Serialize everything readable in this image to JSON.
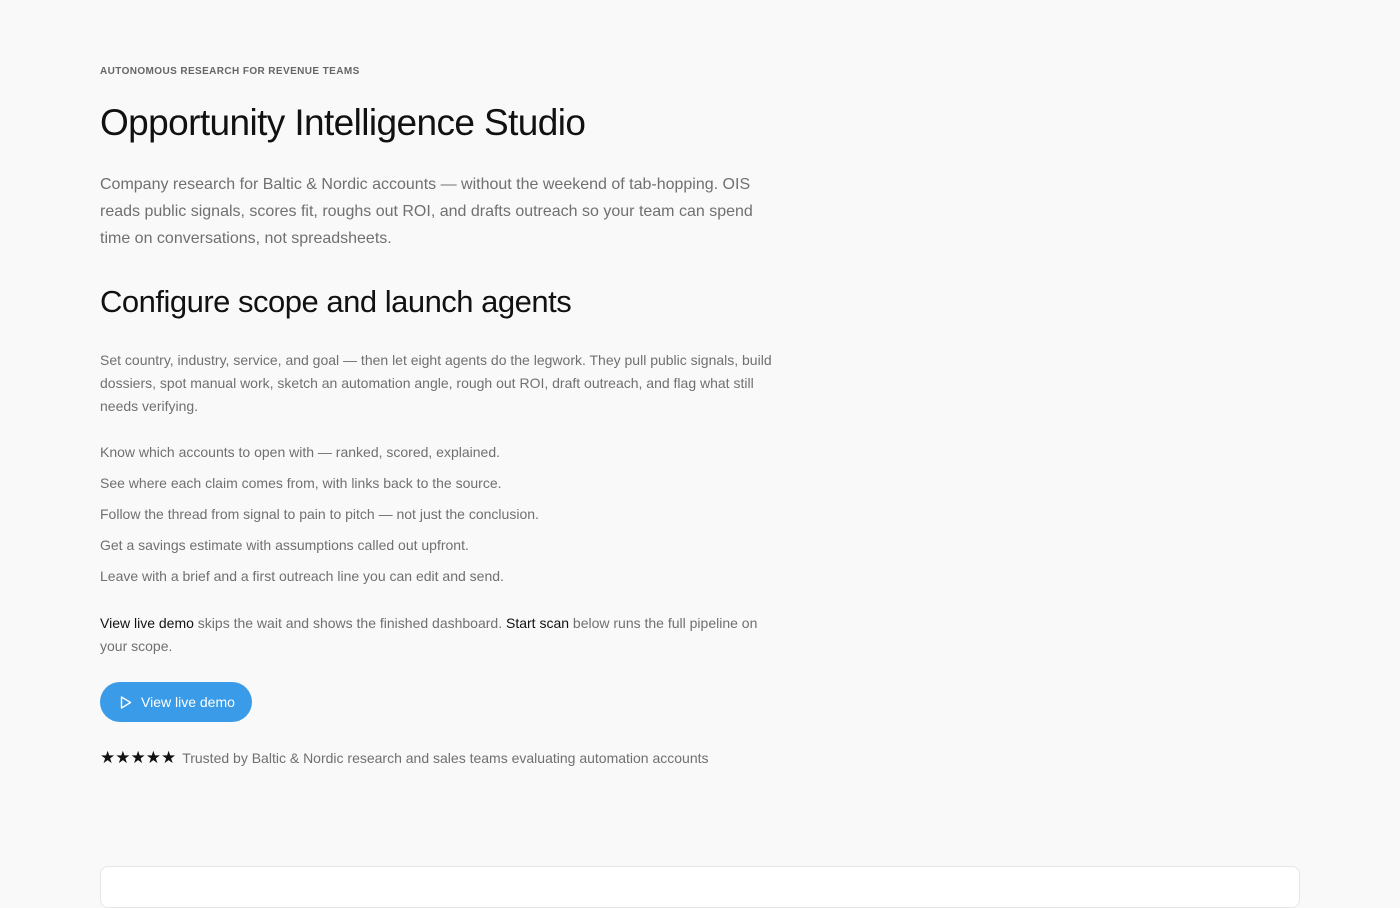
{
  "hero": {
    "eyebrow": "AUTONOMOUS RESEARCH FOR REVENUE TEAMS",
    "title": "Opportunity Intelligence Studio",
    "intro": "Company research for Baltic & Nordic accounts — without the weekend of tab-hopping. OIS reads public signals, scores fit, roughs out ROI, and drafts outreach so your team can spend time on conversations, not spreadsheets."
  },
  "configure": {
    "heading": "Configure scope and launch agents",
    "description": "Set country, industry, service, and goal — then let eight agents do the legwork. They pull public signals, build dossiers, spot manual work, sketch an automation angle, rough out ROI, draft outreach, and flag what still needs verifying.",
    "benefits": [
      "Know which accounts to open with — ranked, scored, explained.",
      "See where each claim comes from, with links back to the source.",
      "Follow the thread from signal to pain to pitch — not just the conclusion.",
      "Get a savings estimate with assumptions called out upfront.",
      "Leave with a brief and a first outreach line you can edit and send."
    ],
    "cta_note": {
      "demo_term": "View live demo",
      "demo_text": " skips the wait and shows the finished dashboard. ",
      "scan_term": "Start scan",
      "scan_text": " below runs the full pipeline on your scope."
    },
    "demo_button_label": "View live demo",
    "demo_button_icon": "play-icon"
  },
  "trust": {
    "stars": "★★★★★",
    "rating": 5,
    "text": "Trusted by Baltic & Nordic research and sales teams evaluating automation accounts"
  },
  "colors": {
    "background": "#f9f9f9",
    "accent": "#3a9be8",
    "heading": "#111111",
    "body_text": "#707070"
  }
}
